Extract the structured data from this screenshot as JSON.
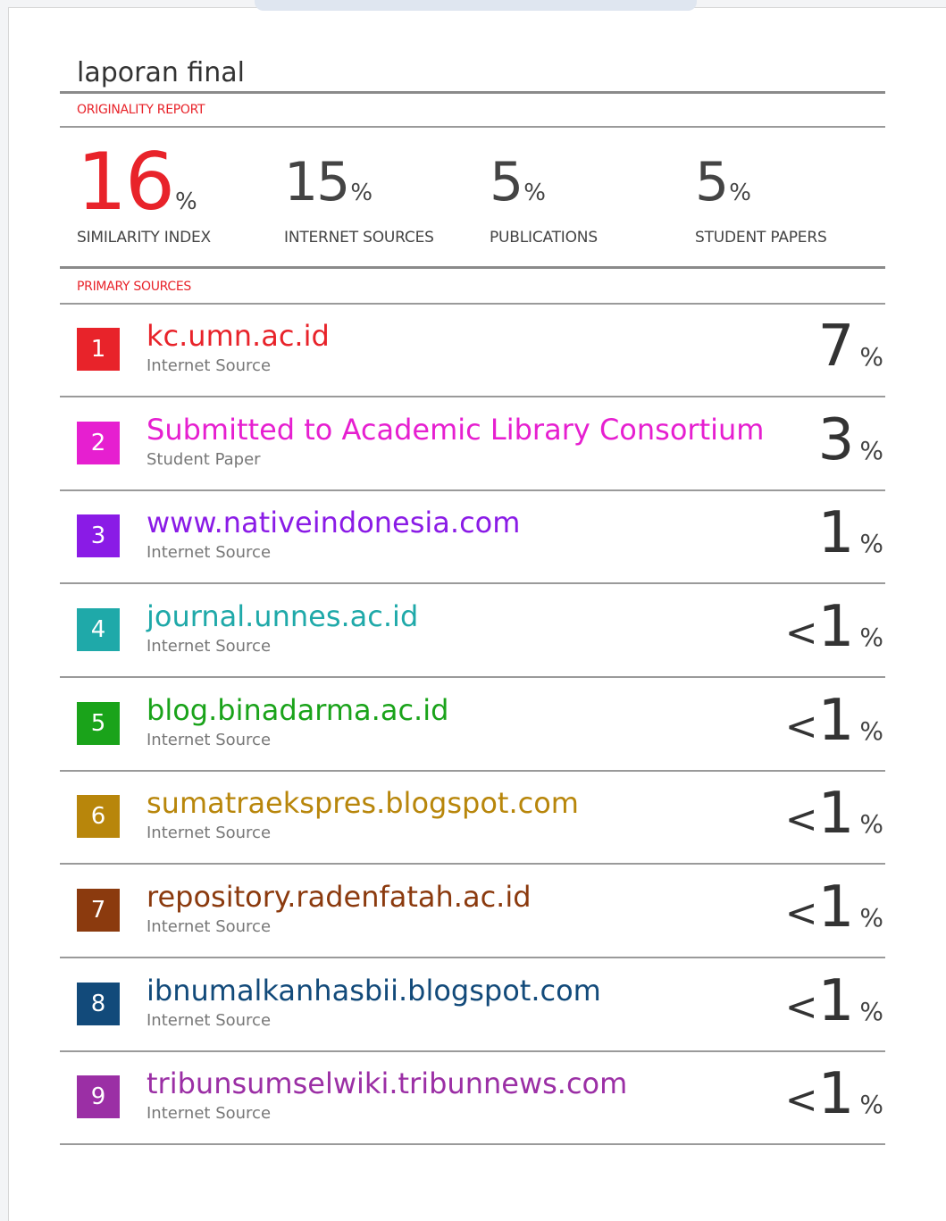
{
  "report": {
    "title": "laporan final",
    "originality_label": "ORIGINALITY REPORT",
    "primary_sources_label": "PRIMARY SOURCES",
    "percent_sign": "%"
  },
  "stats": [
    {
      "value": "16",
      "label": "SIMILARITY INDEX"
    },
    {
      "value": "15",
      "label": "INTERNET SOURCES"
    },
    {
      "value": "5",
      "label": "PUBLICATIONS"
    },
    {
      "value": "5",
      "label": "STUDENT PAPERS"
    }
  ],
  "colors": {
    "accent": "#e8232a",
    "text": "#444444",
    "muted": "#777777"
  },
  "sources": [
    {
      "rank": "1",
      "name": "kc.umn.ac.id",
      "type": "Internet Source",
      "prefix": "",
      "percent": "7",
      "color": "#e8232a"
    },
    {
      "rank": "2",
      "name": "Submitted to Academic Library Consortium",
      "type": "Student Paper",
      "prefix": "",
      "percent": "3",
      "color": "#e61fd0"
    },
    {
      "rank": "3",
      "name": "www.nativeindonesia.com",
      "type": "Internet Source",
      "prefix": "",
      "percent": "1",
      "color": "#8a1be6"
    },
    {
      "rank": "4",
      "name": "journal.unnes.ac.id",
      "type": "Internet Source",
      "prefix": "<",
      "percent": "1",
      "color": "#1fa9a9"
    },
    {
      "rank": "5",
      "name": "blog.binadarma.ac.id",
      "type": "Internet Source",
      "prefix": "<",
      "percent": "1",
      "color": "#1aa31a"
    },
    {
      "rank": "6",
      "name": "sumatraekspres.blogspot.com",
      "type": "Internet Source",
      "prefix": "<",
      "percent": "1",
      "color": "#b8860b"
    },
    {
      "rank": "7",
      "name": "repository.radenfatah.ac.id",
      "type": "Internet Source",
      "prefix": "<",
      "percent": "1",
      "color": "#8b3a0e"
    },
    {
      "rank": "8",
      "name": "ibnumalkanhasbii.blogspot.com",
      "type": "Internet Source",
      "prefix": "<",
      "percent": "1",
      "color": "#124a7a"
    },
    {
      "rank": "9",
      "name": "tribunsumselwiki.tribunnews.com",
      "type": "Internet Source",
      "prefix": "<",
      "percent": "1",
      "color": "#9b2fa5"
    }
  ]
}
